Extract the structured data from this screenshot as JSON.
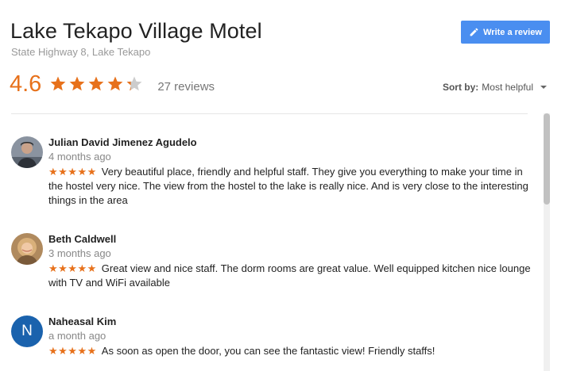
{
  "header": {
    "title": "Lake Tekapo Village Motel",
    "address": "State Highway 8, Lake Tekapo",
    "write_review_label": "Write a review"
  },
  "rating": {
    "value": "4.6",
    "stars_value": 4.6,
    "reviews_label": "27 reviews"
  },
  "sort": {
    "label": "Sort by:",
    "value": "Most helpful"
  },
  "colors": {
    "accent_orange": "#e7711b",
    "button_blue": "#4a8ef0",
    "avatar_blue": "#1a62ad"
  },
  "reviews": [
    {
      "name": "Julian David Jimenez Agudelo",
      "date": "4 months ago",
      "stars": "★★★★★",
      "text": "Very beautiful place, friendly and helpful staff. They give you everything to make your time in the hostel very nice. The view from the hostel to the lake is really nice. And is very close to the interesting things in the area"
    },
    {
      "name": "Beth Caldwell",
      "date": "3 months ago",
      "stars": "★★★★★",
      "text": "Great view and nice staff. The dorm rooms are great value. Well equipped kitchen nice lounge with TV and WiFi available"
    },
    {
      "name": "Naheasal Kim",
      "date": "a month ago",
      "stars": "★★★★★",
      "avatar_letter": "N",
      "text": "As soon as open the door, you can see the fantastic view! Friendly staffs!"
    }
  ]
}
